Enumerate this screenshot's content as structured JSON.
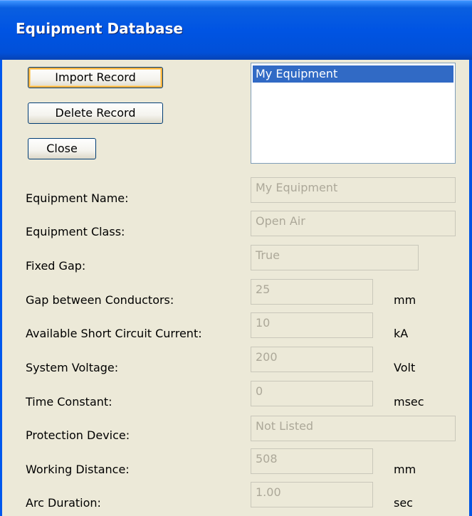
{
  "window": {
    "title": "Equipment Database"
  },
  "buttons": {
    "import": "Import Record",
    "delete": "Delete Record",
    "close": "Close"
  },
  "list": {
    "items": [
      "My Equipment"
    ],
    "selected_index": 0
  },
  "fields": [
    {
      "label": "Equipment Name:",
      "value": "My Equipment",
      "unit": ""
    },
    {
      "label": "Equipment Class:",
      "value": "Open Air",
      "unit": ""
    },
    {
      "label": "Fixed Gap:",
      "value": "True",
      "unit": ""
    },
    {
      "label": "Gap between Conductors:",
      "value": "25",
      "unit": "mm"
    },
    {
      "label": "Available Short Circuit Current:",
      "value": "10",
      "unit": "kA"
    },
    {
      "label": "System Voltage:",
      "value": "200",
      "unit": "Volt"
    },
    {
      "label": "Time Constant:",
      "value": "0",
      "unit": "msec"
    },
    {
      "label": "Protection Device:",
      "value": "Not Listed",
      "unit": ""
    },
    {
      "label": "Working Distance:",
      "value": "508",
      "unit": "mm"
    },
    {
      "label": "Arc Duration:",
      "value": "1.00",
      "unit": "sec"
    }
  ],
  "colors": {
    "titlebar": "#0054E3",
    "selection": "#316AC5",
    "background": "#ECE9D8",
    "disabled_text": "#ACA899"
  }
}
